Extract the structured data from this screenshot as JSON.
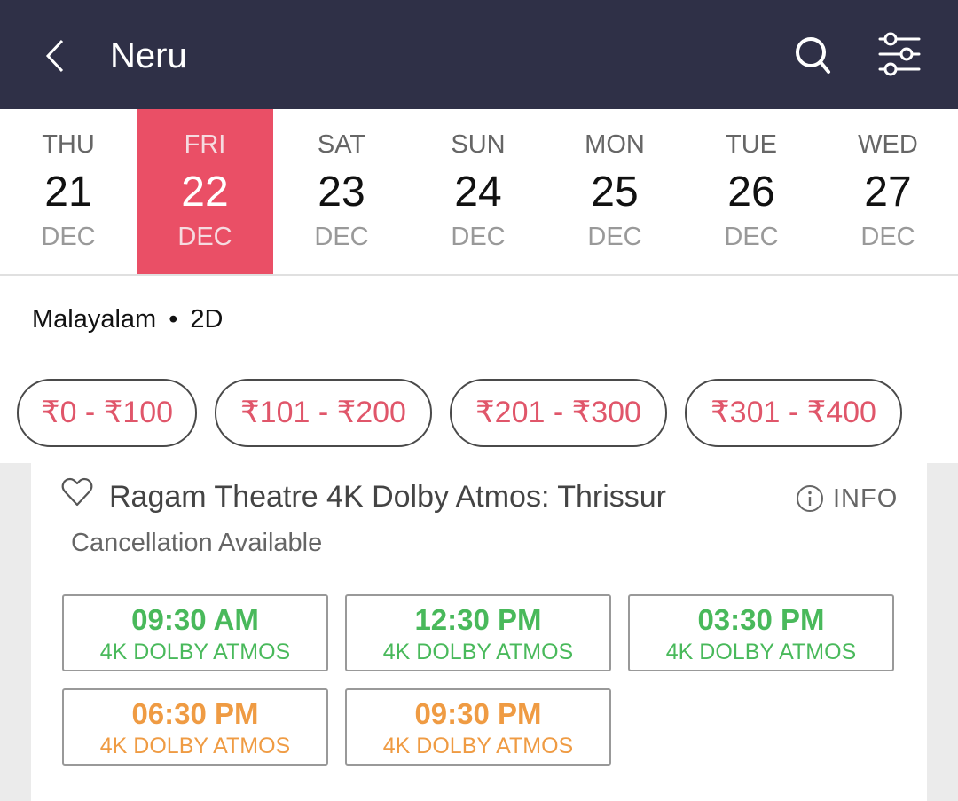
{
  "header": {
    "title": "Neru",
    "back_icon": "chevron-left-icon",
    "search_icon": "search-icon",
    "filter_icon": "sliders-icon"
  },
  "dates": [
    {
      "dow": "THU",
      "day": "21",
      "month": "DEC",
      "selected": false
    },
    {
      "dow": "FRI",
      "day": "22",
      "month": "DEC",
      "selected": true
    },
    {
      "dow": "SAT",
      "day": "23",
      "month": "DEC",
      "selected": false
    },
    {
      "dow": "SUN",
      "day": "24",
      "month": "DEC",
      "selected": false
    },
    {
      "dow": "MON",
      "day": "25",
      "month": "DEC",
      "selected": false
    },
    {
      "dow": "TUE",
      "day": "26",
      "month": "DEC",
      "selected": false
    },
    {
      "dow": "WED",
      "day": "27",
      "month": "DEC",
      "selected": false
    }
  ],
  "meta": {
    "language": "Malayalam",
    "separator": "•",
    "format": "2D"
  },
  "price_filters": [
    {
      "label": "₹0 - ₹100"
    },
    {
      "label": "₹101 - ₹200"
    },
    {
      "label": "₹201 - ₹300"
    },
    {
      "label": "₹301 - ₹400"
    }
  ],
  "theatre": {
    "name": "Ragam Theatre 4K Dolby Atmos: Thrissur",
    "info_label": "INFO",
    "cancellation": "Cancellation Available",
    "showtimes": [
      {
        "time": "09:30 AM",
        "format": "4K DOLBY ATMOS",
        "availability": "available"
      },
      {
        "time": "12:30 PM",
        "format": "4K DOLBY ATMOS",
        "availability": "available"
      },
      {
        "time": "03:30 PM",
        "format": "4K DOLBY ATMOS",
        "availability": "available"
      },
      {
        "time": "06:30 PM",
        "format": "4K DOLBY ATMOS",
        "availability": "filling-fast"
      },
      {
        "time": "09:30 PM",
        "format": "4K DOLBY ATMOS",
        "availability": "filling-fast"
      }
    ]
  },
  "colors": {
    "header_bg": "#2f3047",
    "accent": "#ea4f66",
    "available": "#49b95b",
    "filling_fast": "#ef9b43"
  }
}
